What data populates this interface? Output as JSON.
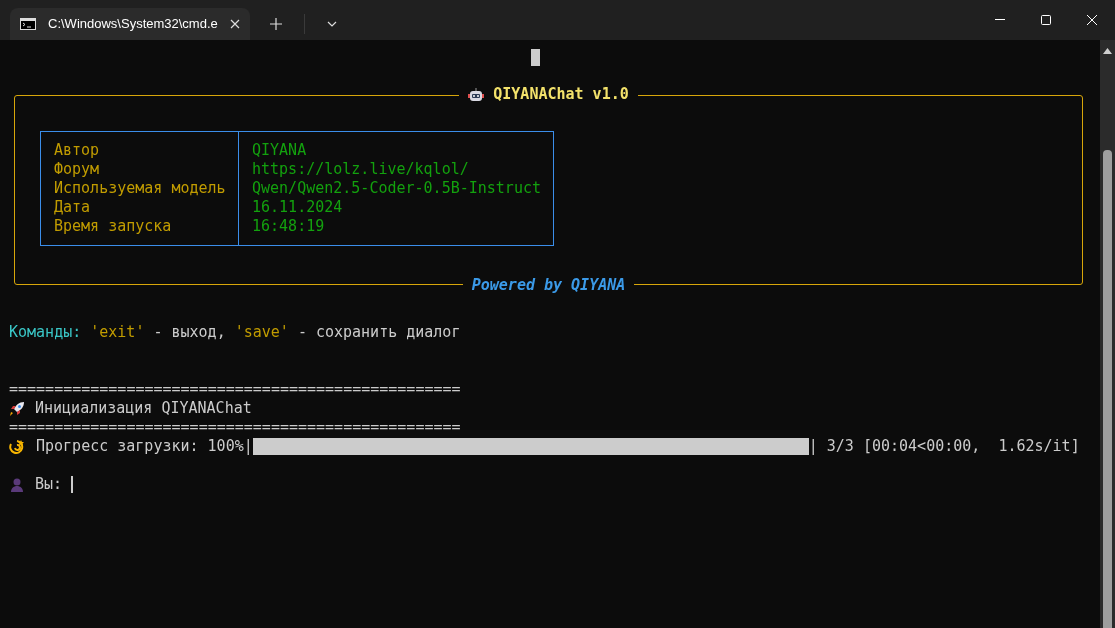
{
  "tab": {
    "title": "C:\\Windows\\System32\\cmd.e"
  },
  "panel": {
    "title": "QIYANAChat v1.0",
    "footer": "Powered by QIYANA",
    "rows": [
      {
        "label": "Автор",
        "value": "QIYANA"
      },
      {
        "label": "Форум",
        "value": "https://lolz.live/kqlol/"
      },
      {
        "label": "Используемая модель",
        "value": "Qwen/Qwen2.5-Coder-0.5B-Instruct"
      },
      {
        "label": "Дата",
        "value": "16.11.2024"
      },
      {
        "label": "Время запуска",
        "value": "16:48:19"
      }
    ]
  },
  "commands": [
    {
      "kind": "label",
      "text": "Команды:"
    },
    {
      "kind": "keyword",
      "text": "'exit'"
    },
    {
      "kind": "plain",
      "text": "- выход,"
    },
    {
      "kind": "keyword",
      "text": "'save'"
    },
    {
      "kind": "plain",
      "text": "- сохранить диалог"
    }
  ],
  "log": [
    {
      "kind": "separator",
      "text": "=================================================="
    },
    {
      "kind": "rocket",
      "text": "Инициализация QIYANAChat"
    },
    {
      "kind": "separator",
      "text": "=================================================="
    }
  ],
  "progress": {
    "label": "Прогресс загрузки: 100%|",
    "level": 1,
    "suffix": "| 3/3 [00:04<00:00,  1.62s/it]"
  },
  "prompt": {
    "label": "Вы:"
  }
}
